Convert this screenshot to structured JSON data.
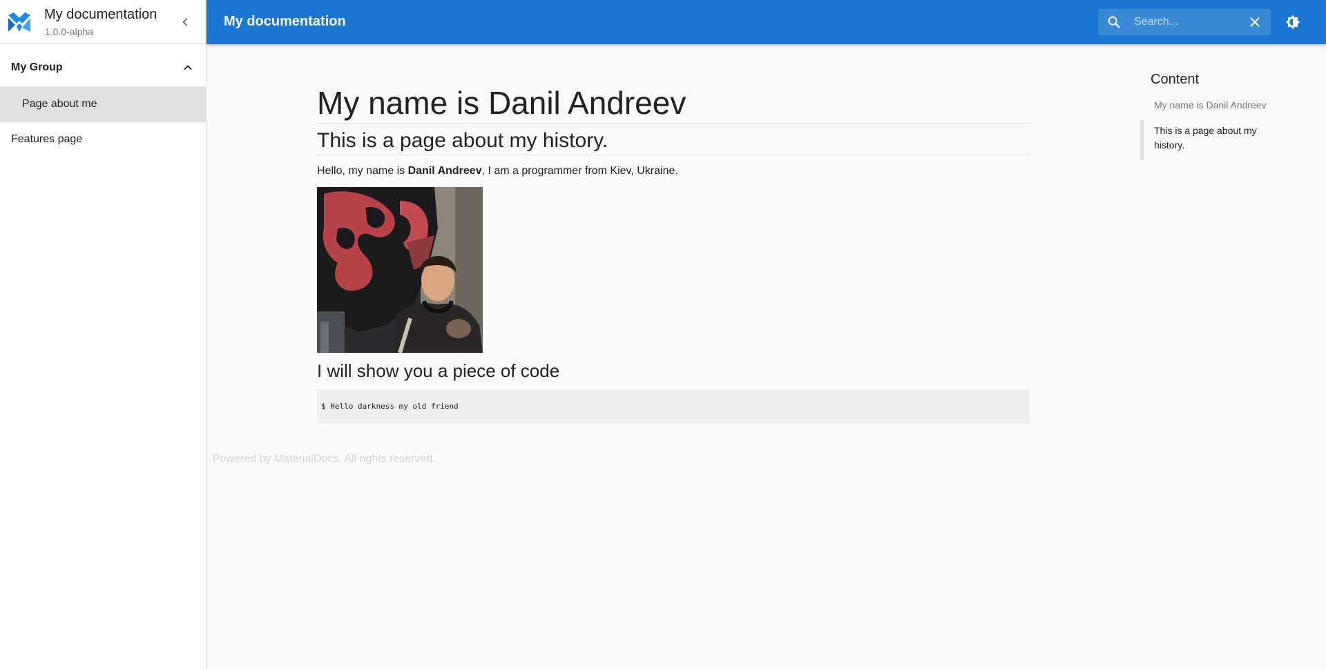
{
  "sidebar": {
    "title": "My documentation",
    "version": "1.0.0-alpha",
    "group": {
      "label": "My Group",
      "items": [
        {
          "label": "Page about me",
          "active": true
        }
      ]
    },
    "items": [
      {
        "label": "Features page"
      }
    ]
  },
  "topbar": {
    "title": "My documentation",
    "search": {
      "placeholder": "Search...",
      "value": ""
    }
  },
  "content": {
    "h1": "My name is Danil Andreev",
    "h2": "This is a page about my history.",
    "para": {
      "before": "Hello, my name is ",
      "bold": "Danil Andreev",
      "after": ", I am a programmer from Kiev, Ukraine."
    },
    "h3": "I will show you a piece of code",
    "code": "$ Hello darkness my old friend"
  },
  "footer": "Powered by MaterialDocs. All rights reserved.",
  "toc": {
    "title": "Content",
    "items": [
      {
        "label": "My name is Danil Andreev"
      },
      {
        "label": "This is a page about my history.",
        "active": true
      }
    ]
  },
  "colors": {
    "primary": "#1976d2",
    "logo_blue": "#1e88e5",
    "active_bg": "#e0e0e0",
    "code_bg": "#eeeeee"
  }
}
